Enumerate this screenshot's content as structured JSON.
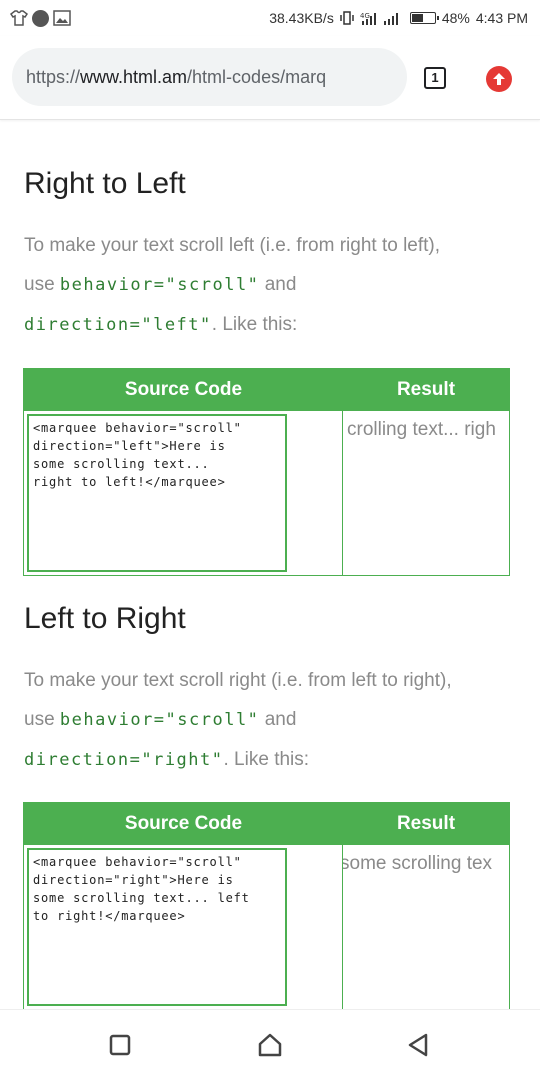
{
  "status_bar": {
    "speed": "38.43KB/s",
    "battery": "48%",
    "battery_level": 0.48,
    "time": "4:43 PM"
  },
  "browser": {
    "url_scheme": "https://",
    "url_host": "www.html.am",
    "url_path": "/html-codes/marq",
    "tab_count": "1"
  },
  "sections": [
    {
      "heading": "Right to Left",
      "intro_1": "To make your text scroll left (i.e. from right to left),",
      "use_label": "use ",
      "code_behavior": "behavior=\"scroll\"",
      "and_label": " and",
      "code_direction": "direction=\"left\"",
      "like_this": ". Like this:",
      "table": {
        "header_source": "Source Code",
        "header_result": "Result",
        "source_code": "<marquee behavior=\"scroll\"\ndirection=\"left\">Here is\nsome scrolling text...\nright to left!</marquee>",
        "result_text": "crolling text... righ"
      }
    },
    {
      "heading": "Left to Right",
      "intro_1": "To make your text scroll right (i.e. from left to right),",
      "use_label": "use ",
      "code_behavior": "behavior=\"scroll\"",
      "and_label": " and",
      "code_direction": "direction=\"right\"",
      "like_this": ". Like this:",
      "table": {
        "header_source": "Source Code",
        "header_result": "Result",
        "source_code": "<marquee behavior=\"scroll\"\ndirection=\"right\">Here is\nsome scrolling text... left\nto right!</marquee>",
        "result_text": "some scrolling tex"
      }
    }
  ],
  "nav": {
    "recents_icon": "square-icon",
    "home_icon": "home-icon",
    "back_icon": "back-triangle-icon"
  },
  "colors": {
    "accent_green": "#4caf50",
    "code_green": "#2e7d32",
    "update_red": "#e53935"
  }
}
